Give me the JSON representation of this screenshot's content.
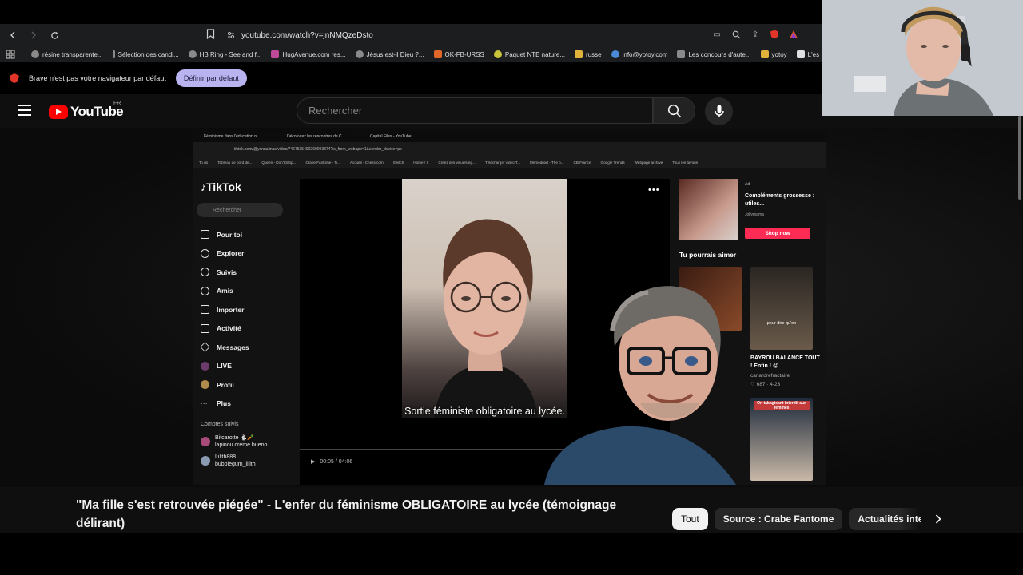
{
  "browser": {
    "url": "youtube.com/watch?v=jnNMQzeDsto",
    "bookmarks": [
      {
        "label": "résine transparente...",
        "color": "#8a8a8a"
      },
      {
        "label": "Sélection des candi...",
        "color": "#8a8a8a"
      },
      {
        "label": "HB Ring - See and f...",
        "color": "#8a8a8a"
      },
      {
        "label": "HugAvenue.com res...",
        "color": "#c04a9a"
      },
      {
        "label": "Jésus est-il Dieu ?...",
        "color": "#8a8a8a"
      },
      {
        "label": "OK-FB-URSS",
        "color": "#e0662a"
      },
      {
        "label": "Paquet NTB nature...",
        "color": "#c9c23a"
      },
      {
        "label": "russe",
        "color": "#e0b23a"
      },
      {
        "label": "info@yotoy.com",
        "color": "#4a8ad6"
      },
      {
        "label": "Les concours d'aute...",
        "color": "#8a8a8a"
      },
      {
        "label": "yotoy",
        "color": "#e0b23a"
      },
      {
        "label": "L'es",
        "color": "#e0e0e0"
      }
    ],
    "notice_text": "Brave n'est pas votre navigateur par défaut",
    "notice_button": "Définir par défaut"
  },
  "youtube": {
    "logo_text": "YouTube",
    "region": "FR",
    "search_placeholder": "Rechercher",
    "video_title": "\"Ma fille s'est retrouvée piégée\" - L'enfer du féminisme OBLIGATOIRE au lycée (témoignage délirant)",
    "chips": [
      "Tout",
      "Source : Crabe Fantome",
      "Actualités inte"
    ]
  },
  "inner": {
    "tabs": [
      "Féminisme dans l'éducation n...",
      "Découvrez les rencontres de C...",
      "Capital Files - YouTube"
    ],
    "address": "tiktok.com/@yannalinas/video/7467535490260093374?is_from_webapp=1&sender_device=pc",
    "bookmarks": [
      "To do",
      "Tableau de bord de...",
      "Queen - Don't Stop...",
      "Crabe Fantome - Ti...",
      "Accueil - Chess.com",
      "Switch",
      "Home / X",
      "Créez des visuels ép...",
      "Télécharger vidéo T...",
      "Memedroid - The b...",
      "CB France",
      "Google Trends",
      "Webpage archive",
      "Tous les favoris"
    ],
    "tiktok_logo": "TikTok",
    "tiktok_search": "Rechercher",
    "nav": [
      "Pour toi",
      "Explorer",
      "Suivis",
      "Amis",
      "Importer",
      "Activité",
      "Messages",
      "LIVE",
      "Profil",
      "Plus"
    ],
    "following_title": "Comptes suivis",
    "following": [
      {
        "name": "Bitcarotte 🐇🥕",
        "handle": "lapinou.creme.bueno"
      },
      {
        "name": "Lilith888",
        "handle": "bubblegum_lilith"
      }
    ],
    "caption": "Sortie féministe obligatoire au lycée.",
    "time": "00:05 / 04:06",
    "ad_label": "Ad",
    "ad_title": "Compléments grossesse : utiles...",
    "ad_brand": "Jollymama",
    "ad_button": "Shop now",
    "suggest_title": "Tu pourrais aimer",
    "suggest_video_title": "BAYROU BALANCE TOUT ! Enfin ! 😡",
    "suggest_channel": "canardrefractaire",
    "suggest_stats": "♡ 687 · 4-23",
    "suggest_overlay_1": "pour dire qu'on",
    "suggest_overlay_2": "On tabagisant interdit aux femmes"
  }
}
